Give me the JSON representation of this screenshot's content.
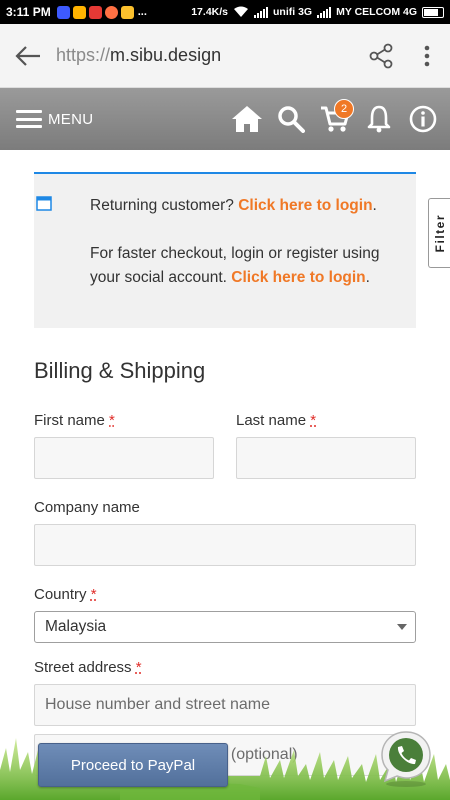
{
  "status_bar": {
    "time": "3:11 PM",
    "speed": "17.4K/s",
    "dots": "...",
    "network1": "unifi 3G",
    "network2": "MY CELCOM 4G"
  },
  "browser": {
    "url_scheme": "https://",
    "url_host": "m.sibu.design"
  },
  "site_nav": {
    "menu_label": "MENU",
    "cart_count": "2"
  },
  "notice": {
    "returning_text": "Returning customer? ",
    "returning_link": "Click here to login",
    "returning_end": ".",
    "social_text": "For faster checkout, login or register using your social account. ",
    "social_link": "Click here to login",
    "social_end": "."
  },
  "form": {
    "section_title": "Billing & Shipping",
    "first_name_label": "First name",
    "last_name_label": "Last name",
    "company_label": "Company name",
    "country_label": "Country",
    "country_value": "Malaysia",
    "street_label": "Street address",
    "street_placeholder": "House number and street name",
    "apartment_placeholder": "Apartment, suite, unit etc. (optional)",
    "required_mark": "*"
  },
  "filter_tab": "Filter",
  "paypal_button": "Proceed to PayPal",
  "colors": {
    "accent_orange": "#f07826",
    "nav_gray": "#8a8a8a",
    "notice_border": "#1e88e5",
    "paypal_blue": "#5e7ca8"
  }
}
